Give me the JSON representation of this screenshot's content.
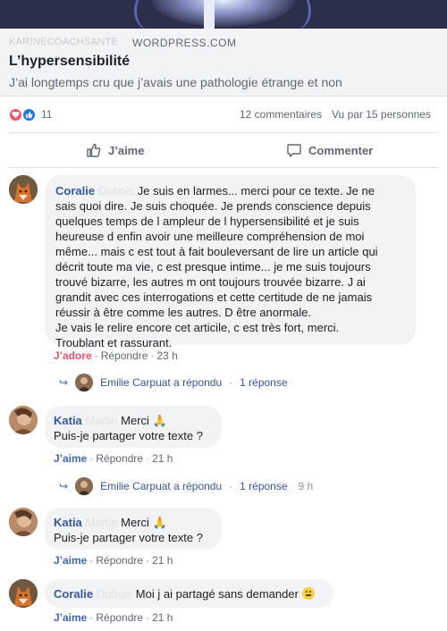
{
  "link": {
    "source_blurred": "KARINECOACHSANTE",
    "domain": "WORDPRESS.COM",
    "title": "L’hypersensibilité",
    "description": "J’ai longtemps cru que j’avais une pathologie étrange et non"
  },
  "stats": {
    "reaction_count": "11",
    "comments": "12 commentaires",
    "seen": "Vu par 15 personnes"
  },
  "actions": {
    "like_label": "J’aime",
    "comment_label": "Commenter"
  },
  "comments": [
    {
      "author": "Coralie",
      "author_hidden": "Dubois",
      "text_first": "Je suis en larmes... merci pour ce texte. Je ne",
      "text_lines": [
        "sais quoi dire. Je suis choquée. Je prends conscience depuis",
        "quelques temps de l ampleur de l hypersensibilité et je suis",
        "heureuse d enfin avoir une meilleure compréhension de moi",
        "même... mais c est tout à fait bouleversant de lire un article qui",
        "décrit toute ma vie, c est presque intime... je me suis toujours",
        "trouvé bizarre, les autres m ont toujours trouvée bizarre. J ai",
        "grandit avec ces interrogations et cette certitude de ne jamais",
        "réussir à être comme les autres. D être anormale.",
        "Je vais le relire encore cet articile, c est très fort, merci.",
        "Troublant et rassurant."
      ],
      "reaction": "J’adore",
      "reply": "Répondre",
      "time": "23 h",
      "replies": {
        "text": "Emilie Carpuat a répondu",
        "count": "1 réponse",
        "time": ""
      }
    },
    {
      "author": "Katia",
      "author_hidden": "Martin",
      "text_first": "Merci 🙏",
      "text_lines": [
        "Puis-je partager votre texte ?"
      ],
      "reaction": "J’aime",
      "reply": "Répondre",
      "time": "21 h",
      "replies": {
        "text": "Emilie Carpuat a répondu",
        "count": "1 réponse",
        "time": "9 h"
      }
    },
    {
      "author": "Katia",
      "author_hidden": "Martin",
      "text_first": "Merci 🙏",
      "text_lines": [
        "Puis-je partager votre texte ?"
      ],
      "reaction": "J’aime",
      "reply": "Répondre",
      "time": "21 h"
    },
    {
      "author": "Coralie",
      "author_hidden": "Dubois",
      "text_first": "Moi j ai partagé sans demander",
      "text_lines": [],
      "emoji": "smiley-emoji",
      "reaction": "J’aime",
      "reply": "Répondre",
      "time": "21 h"
    }
  ],
  "icons": {
    "love": "heart-icon",
    "like": "thumbs-up-icon",
    "comment": "speech-bubble-icon",
    "reply_arrow": "reply-arrow-icon"
  },
  "colors": {
    "link_blue": "#365899",
    "love_red": "#f25268",
    "like_blue": "#1877f2"
  }
}
